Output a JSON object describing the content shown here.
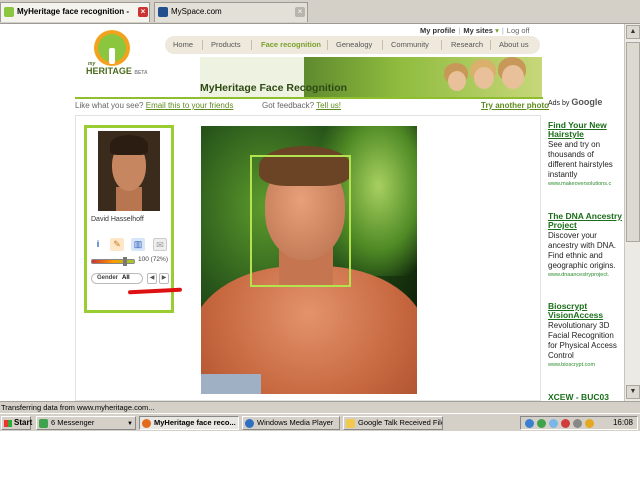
{
  "browser": {
    "tabs": [
      {
        "label": "MyHeritage face recognition - cel...",
        "active": true
      },
      {
        "label": "MySpace.com",
        "active": false
      }
    ],
    "status": "Transferring data from www.myheritage.com..."
  },
  "site": {
    "toplinks": [
      "My profile",
      "My sites",
      "Log off"
    ],
    "logo": {
      "my": "my",
      "name": "HERITAGE",
      "beta": "BETA"
    },
    "nav": [
      "Home",
      "Products",
      "Face recognition",
      "Genealogy",
      "Community",
      "Research",
      "About us"
    ],
    "active_nav": "Face recognition",
    "banner_title": "MyHeritage Face Recognition",
    "feedback": {
      "like_text": "Like what you see?",
      "email_link": "Email this to your friends",
      "got_text": "Got feedback?",
      "tell_link": "Tell us!",
      "try_link": "Try another photo"
    }
  },
  "result": {
    "name": "David Hasselhoff",
    "match_label": "100 (72%)",
    "match_level": 0.72,
    "gender_label": "Gender",
    "gender_value": "All",
    "icons": [
      "info-icon",
      "pencil-icon",
      "book-icon",
      "email-icon"
    ]
  },
  "ads": {
    "ads_by": "Ads by",
    "google": "Google",
    "items": [
      {
        "title": "Find Your New Hairstyle",
        "desc": "See and try on thousands of different hairstyles instantly",
        "url": "www.makeoversolutions.c"
      },
      {
        "title": "The DNA Ancestry Project",
        "desc": "Discover your ancestry with DNA. Find ethnic and geographic origins.",
        "url": "www.dnaancestryproject."
      },
      {
        "title": "Bioscrypt VisionAccess",
        "desc": "Revolutionary 3D Facial Recognition for Physical Access Control",
        "url": "www.bioscrypt.com"
      },
      {
        "title": "XCEW - BUC03",
        "desc": "",
        "url": ""
      }
    ]
  },
  "taskbar": {
    "start": "Start",
    "items": [
      {
        "label": "6 Messenger",
        "active": false
      },
      {
        "label": "MyHeritage face reco...",
        "active": true
      },
      {
        "label": "Windows Media Player",
        "active": false
      },
      {
        "label": "Google Talk Received Files",
        "active": false
      }
    ],
    "clock": "16:08"
  },
  "colors": {
    "accent_green": "#8fbf2f",
    "link_green": "#5c8a1c",
    "ad_title_green": "#1a6e1a",
    "facebox": "#b5e24f",
    "annotation_red": "#d11"
  }
}
